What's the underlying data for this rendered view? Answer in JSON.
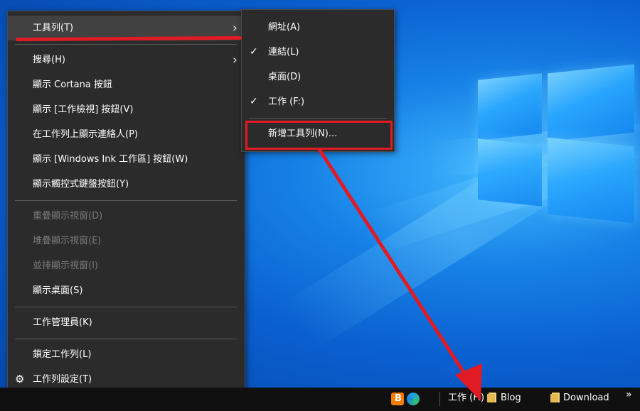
{
  "menu": {
    "items": [
      {
        "label": "工具列(T)",
        "submenu": true,
        "highlighted": true
      },
      {
        "label": "搜尋(H)",
        "submenu": true
      },
      {
        "label": "顯示 Cortana 按鈕"
      },
      {
        "label": "顯示 [工作檢視] 按鈕(V)"
      },
      {
        "label": "在工作列上顯示連絡人(P)"
      },
      {
        "label": "顯示 [Windows Ink 工作區] 按鈕(W)"
      },
      {
        "label": "顯示觸控式鍵盤按鈕(Y)"
      },
      {
        "label": "重疊顯示視窗(D)",
        "disabled": true
      },
      {
        "label": "堆疊顯示視窗(E)",
        "disabled": true
      },
      {
        "label": "並排顯示視窗(I)",
        "disabled": true
      },
      {
        "label": "顯示桌面(S)"
      },
      {
        "label": "工作管理員(K)"
      },
      {
        "label": "鎖定工作列(L)"
      },
      {
        "label": "工作列設定(T)",
        "icon": "gear-icon"
      }
    ]
  },
  "submenu": {
    "items": [
      {
        "label": "網址(A)",
        "checked": false
      },
      {
        "label": "連結(L)",
        "checked": true
      },
      {
        "label": "桌面(D)",
        "checked": false
      },
      {
        "label": "工作 (F:)",
        "checked": true
      },
      {
        "label": "新增工具列(N)...",
        "checked": false
      }
    ]
  },
  "taskbar": {
    "apps": [
      {
        "name": "blogger-icon",
        "color": "#f57d00"
      },
      {
        "name": "edge-icon",
        "color": "#1fa0e3"
      }
    ],
    "toolbar_label": "工作 (F:)",
    "links": [
      {
        "label": "Blog",
        "icon": "folder-icon"
      },
      {
        "label": "Download",
        "icon": "folder-icon"
      }
    ],
    "overflow": "»"
  },
  "colors": {
    "annotation_red": "#e01b24",
    "menu_bg": "#2b2b2b",
    "taskbar_bg": "#101010"
  }
}
